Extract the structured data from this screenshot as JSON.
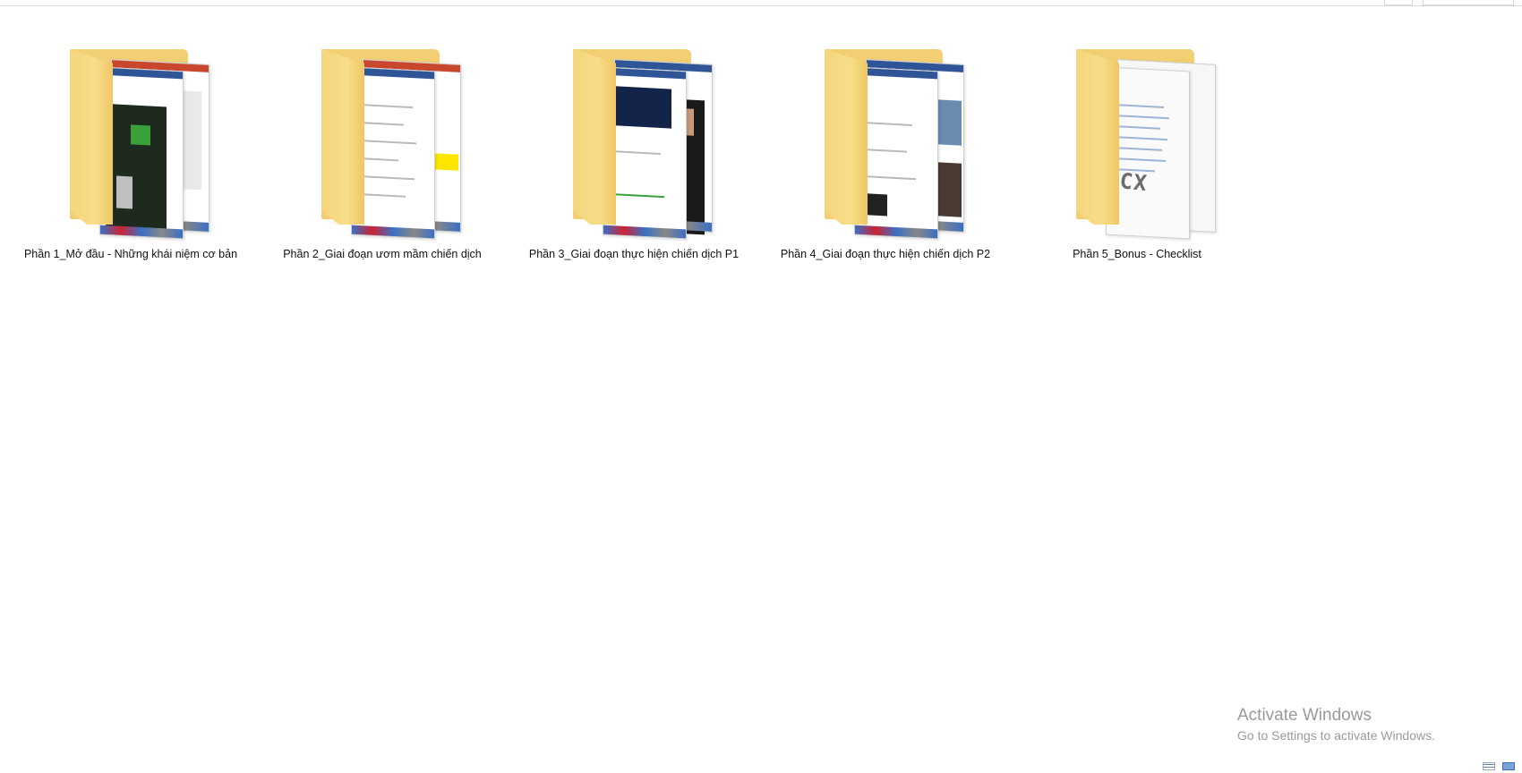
{
  "explorer": {
    "items": [
      {
        "name": "Phần 1_Mở đầu - Những khái niệm cơ bản",
        "type": "folder"
      },
      {
        "name": "Phần 2_Giai đoạn ươm mầm chiến dịch",
        "type": "folder"
      },
      {
        "name": "Phần 3_Giai đoạn thực hiện chiến dịch P1",
        "type": "folder"
      },
      {
        "name": "Phần 4_Giai đoạn thực hiện chiến dịch P2",
        "type": "folder"
      },
      {
        "name": "Phần 5_Bonus - Checklist",
        "type": "folder",
        "preview": "DOCX"
      }
    ]
  },
  "watermark": {
    "title": "Activate Windows",
    "subtitle": "Go to Settings to activate Windows."
  },
  "icons": {
    "folder": "folder-icon",
    "details_view": "details-view-icon",
    "large_icons_view": "large-icons-view-icon"
  },
  "colors": {
    "folder": "#f2cf73",
    "watermark_text": "#9a9a9a"
  }
}
